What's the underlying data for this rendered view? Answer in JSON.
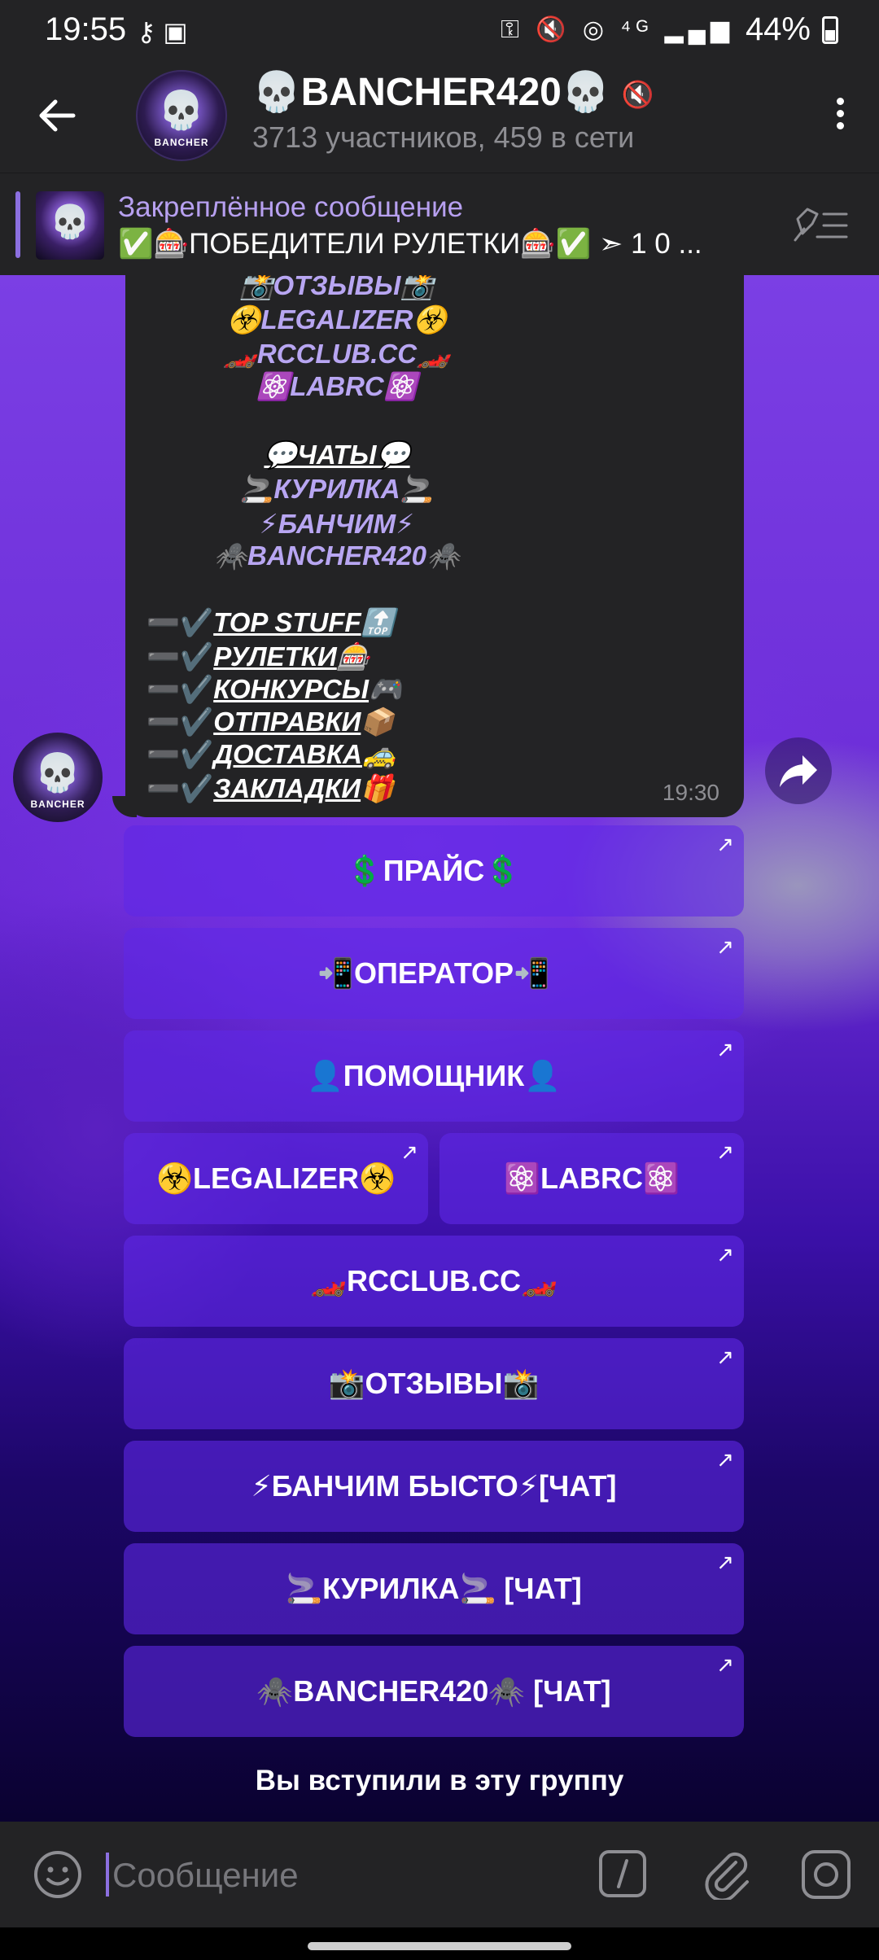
{
  "status_bar": {
    "time": "19:55",
    "left_icons": "⚷ ▣",
    "right_icons": "⚿ 🔇 ◎ ⁴ᴳ ▂▄▆",
    "battery": "44%"
  },
  "header": {
    "title": "💀BANCHER420💀",
    "subtitle": "3713 участников, 459 в сети",
    "avatar_label": "BANCHER",
    "icons": [
      "back-arrow-icon",
      "mute-icon",
      "more-vertical-icon"
    ]
  },
  "pinned": {
    "title": "Закреплённое сообщение",
    "text": "✅🎰ПОБЕДИТЕЛИ РУЛЕТКИ🎰✅ ➣ 1 0 ..."
  },
  "message": {
    "links_top": [
      "📸ОТЗЫВЫ📸",
      "☣️LEGALIZER☣️",
      "🏎️RCCLUB.CC🏎️",
      "⚛️LABRC⚛️"
    ],
    "chats_header": "💬ЧАТЫ💬",
    "chats": [
      "🚬КУРИЛКА🚬",
      "⚡БАНЧИМ⚡",
      "🕷️BANCHER420🕷️"
    ],
    "items": [
      {
        "dash": "➖✔️",
        "text": "TOP STUFF",
        "emoji": "🔝"
      },
      {
        "dash": "➖✔️",
        "text": "РУЛЕТКИ",
        "emoji": "🎰"
      },
      {
        "dash": "➖✔️",
        "text": "КОНКУРСЫ",
        "emoji": "🎮"
      },
      {
        "dash": "➖✔️",
        "text": "ОТПРАВКИ",
        "emoji": "📦"
      },
      {
        "dash": "➖✔️",
        "text": "ДОСТАВКА",
        "emoji": "🚕"
      },
      {
        "dash": "➖✔️",
        "text": "ЗАКЛАДКИ",
        "emoji": "🎁"
      }
    ],
    "time": "19:30"
  },
  "keyboard": {
    "arrow": "↗",
    "buttons": [
      "💲ПРАЙС💲",
      "📲ОПЕРАТОР📲",
      "👤ПОМОЩНИК👤",
      "☣️LEGALIZER☣️",
      "⚛️LABRC⚛️",
      "🏎️RCCLUB.CC🏎️",
      "📸ОТЗЫВЫ📸",
      "⚡БАНЧИМ БЫСТО⚡[ЧАТ]",
      "🚬КУРИЛКА🚬 [ЧАТ]",
      "🕷️BANCHER420🕷️ [ЧАТ]"
    ]
  },
  "service_message": "Вы вступили в эту группу",
  "composer": {
    "placeholder": "Сообщение",
    "icons": [
      "emoji-icon",
      "slash-command-icon",
      "paperclip-icon",
      "camera-icon"
    ]
  },
  "colors": {
    "accent": "#8b6fe0",
    "bubble": "#232325",
    "header": "#232325",
    "button": "#6a2ae8"
  }
}
